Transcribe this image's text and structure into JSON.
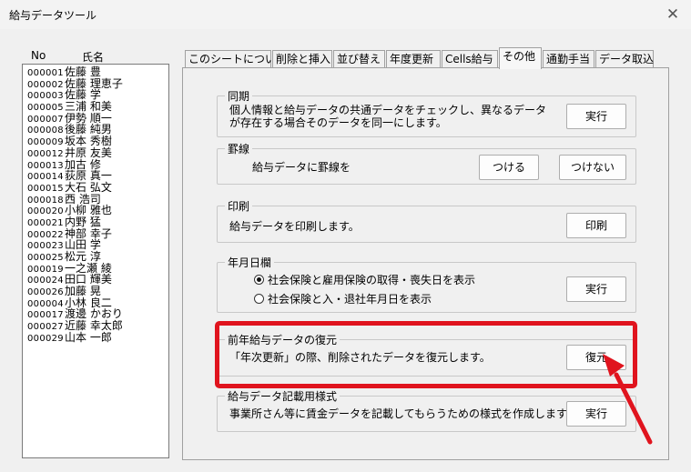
{
  "window": {
    "title": "給与データツール",
    "close_glyph": "✕"
  },
  "employee_list": {
    "header_no": "No",
    "header_name": "氏名",
    "rows": [
      {
        "no": "000001",
        "name": "佐藤 豊"
      },
      {
        "no": "000002",
        "name": "佐藤 理恵子"
      },
      {
        "no": "000003",
        "name": "佐藤 学"
      },
      {
        "no": "000005",
        "name": "三浦 和美"
      },
      {
        "no": "000007",
        "name": "伊勢 順一"
      },
      {
        "no": "000008",
        "name": "後藤 純男"
      },
      {
        "no": "000009",
        "name": "坂本 秀樹"
      },
      {
        "no": "000012",
        "name": "井原 友美"
      },
      {
        "no": "000013",
        "name": "加古 修"
      },
      {
        "no": "000014",
        "name": "荻原 真一"
      },
      {
        "no": "000015",
        "name": "大石 弘文"
      },
      {
        "no": "000018",
        "name": "西 浩司"
      },
      {
        "no": "000020",
        "name": "小柳 雅也"
      },
      {
        "no": "000021",
        "name": "内野 猛"
      },
      {
        "no": "000022",
        "name": "神部 幸子"
      },
      {
        "no": "000023",
        "name": "山田 学"
      },
      {
        "no": "000025",
        "name": "松元 淳"
      },
      {
        "no": "000019",
        "name": "一之瀬 綾"
      },
      {
        "no": "000024",
        "name": "田口 輝美"
      },
      {
        "no": "000026",
        "name": "加藤 晃"
      },
      {
        "no": "000004",
        "name": "小林 良二"
      },
      {
        "no": "000017",
        "name": "渡邊 かおり"
      },
      {
        "no": "000027",
        "name": "近藤 幸太郎"
      },
      {
        "no": "000029",
        "name": "山本 一郎"
      }
    ]
  },
  "tabs": [
    {
      "label": "このシートについて"
    },
    {
      "label": "削除と挿入"
    },
    {
      "label": "並び替え"
    },
    {
      "label": "年度更新"
    },
    {
      "label": "Cells給与"
    },
    {
      "label": "その他",
      "active": true
    },
    {
      "label": "通勤手当"
    },
    {
      "label": "データ取込"
    }
  ],
  "sections": {
    "sync": {
      "title": "同期",
      "line1": "個人情報と給与データの共通データをチェックし、異なるデータ",
      "line2": "が存在する場合そのデータを同一にします。",
      "button": "実行"
    },
    "border": {
      "title": "罫線",
      "text": "給与データに罫線を",
      "button_add": "つける",
      "button_remove": "つけない"
    },
    "print": {
      "title": "印刷",
      "text": "給与データを印刷します。",
      "button": "印刷"
    },
    "date": {
      "title": "年月日欄",
      "option1": "社会保険と雇用保険の取得・喪失日を表示",
      "option2": "社会保険と入・退社年月日を表示",
      "selected": 1,
      "button": "実行"
    },
    "restore": {
      "title": "前年給与データの復元",
      "text": "「年次更新」の際、削除されたデータを復元します。",
      "button": "復元"
    },
    "format": {
      "title": "給与データ記載用様式",
      "text": "事業所さん等に賃金データを記載してもらうための様式を作成します。",
      "button": "実行"
    }
  },
  "annotation": {
    "color": "#e0141e"
  }
}
